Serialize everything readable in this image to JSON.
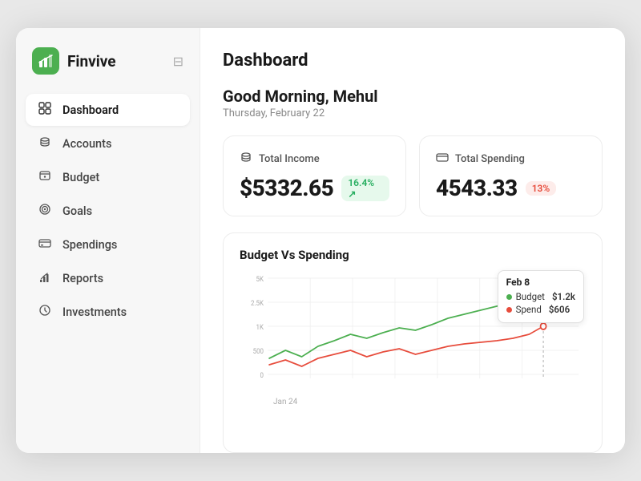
{
  "app": {
    "name": "Finvive",
    "logo_char": "₣"
  },
  "sidebar": {
    "collapse_icon": "⊟",
    "items": [
      {
        "id": "dashboard",
        "label": "Dashboard",
        "icon": "⌂",
        "active": true
      },
      {
        "id": "accounts",
        "label": "Accounts",
        "icon": "◫"
      },
      {
        "id": "budget",
        "label": "Budget",
        "icon": "◉"
      },
      {
        "id": "goals",
        "label": "Goals",
        "icon": "◎"
      },
      {
        "id": "spendings",
        "label": "Spendings",
        "icon": "▬"
      },
      {
        "id": "reports",
        "label": "Reports",
        "icon": "▦"
      },
      {
        "id": "investments",
        "label": "Investments",
        "icon": "◈"
      }
    ]
  },
  "main": {
    "title": "Dashboard",
    "greeting": "Good Morning, Mehul",
    "date": "Thursday, February 22",
    "cards": [
      {
        "id": "total-income",
        "label": "Total Income",
        "icon": "◑",
        "amount": "$5332.65",
        "badge": "16.4% ↗",
        "badge_type": "green"
      },
      {
        "id": "total-spending",
        "label": "Total Spending",
        "icon": "▣",
        "amount": "4543.33",
        "badge": "13%",
        "badge_type": "red"
      }
    ],
    "chart": {
      "title": "Budget Vs Spending",
      "tooltip": {
        "date": "Feb 8",
        "budget_label": "Budget",
        "budget_value": "$1.2k",
        "spend_label": "Spend",
        "spend_value": "$606"
      },
      "y_labels": [
        "5K",
        "2.5K",
        "1K",
        "500",
        "0"
      ],
      "x_label": "Jan 24"
    }
  }
}
